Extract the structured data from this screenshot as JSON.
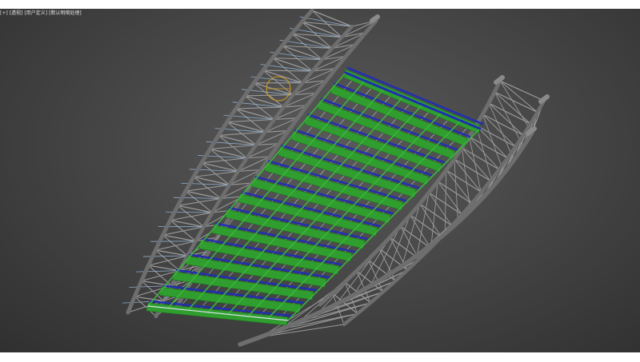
{
  "viewport": {
    "label_segments": [
      "[+]",
      "[透视]",
      "[用户定义]",
      "[默认明暗处理]"
    ],
    "background_color": "#474747"
  },
  "model": {
    "truss_color": "#9a9a9a",
    "chord_color": "#6e6e6e",
    "brace_color": "#8eaed0",
    "panel_color": "#2f9e2f",
    "purlin_color": "#1f2fb0",
    "gizmo_color": "#d4a020"
  }
}
